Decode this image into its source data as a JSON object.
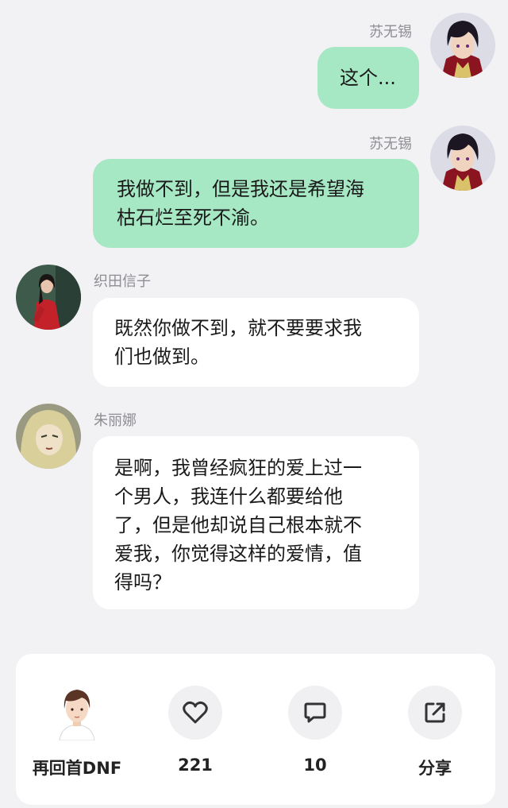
{
  "messages": [
    {
      "sender": "苏无锡",
      "side": "right",
      "lines": [
        "这个..."
      ]
    },
    {
      "sender": "苏无锡",
      "side": "right",
      "lines": [
        "我做不到，但是我还是希望海",
        "枯石烂至死不渝。"
      ]
    },
    {
      "sender": "织田信子",
      "side": "left",
      "lines": [
        "既然你做不到，就不要要求我",
        "们也做到。"
      ]
    },
    {
      "sender": "朱丽娜",
      "side": "left",
      "lines": [
        "是啊，我曾经疯狂的爱上过一",
        "个男人，我连什么都要给他",
        "了，但是他却说自己根本就不",
        "爱我，你觉得这样的爱情，值",
        "得吗？"
      ]
    }
  ],
  "action_bar": {
    "author": "再回首DNF",
    "likes": "221",
    "comments": "10",
    "share": "分享"
  },
  "icons": [
    "heart-icon",
    "comment-icon",
    "share-icon"
  ],
  "colors": {
    "bubble_right": "#a6e8c4",
    "bubble_left": "#ffffff",
    "background": "#f2f2f5"
  }
}
